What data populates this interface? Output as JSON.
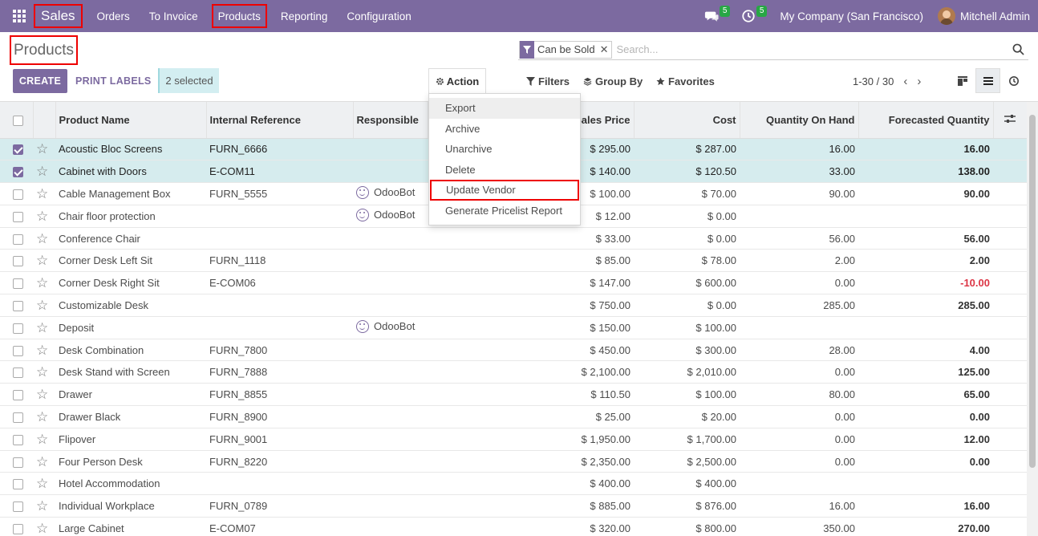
{
  "navbar": {
    "app_name": "Sales",
    "menus": [
      "Orders",
      "To Invoice",
      "Products",
      "Reporting",
      "Configuration"
    ],
    "messages_count": "5",
    "activities_count": "5",
    "company": "My Company (San Francisco)",
    "user": "Mitchell Admin"
  },
  "page": {
    "title": "Products",
    "create_label": "CREATE",
    "print_labels_label": "PRINT LABELS",
    "selected_label": "2 selected",
    "action_label": "Action",
    "filters_label": "Filters",
    "group_by_label": "Group By",
    "favorites_label": "Favorites",
    "pager": "1-30 / 30"
  },
  "search": {
    "facet": "Can be Sold",
    "placeholder": "Search..."
  },
  "action_menu": [
    "Export",
    "Archive",
    "Unarchive",
    "Delete",
    "Update Vendor",
    "Generate Pricelist Report"
  ],
  "table": {
    "columns": [
      "Product Name",
      "Internal Reference",
      "Responsible",
      "Sales Price",
      "Cost",
      "Quantity On Hand",
      "Forecasted Quantity"
    ],
    "rows": [
      {
        "name": "Acoustic Bloc Screens",
        "ref": "FURN_6666",
        "resp": "",
        "price": "$ 295.00",
        "cost": "$ 287.00",
        "qoh": "16.00",
        "fq": "16.00",
        "selected": true
      },
      {
        "name": "Cabinet with Doors",
        "ref": "E-COM11",
        "resp": "",
        "price": "$ 140.00",
        "cost": "$ 120.50",
        "qoh": "33.00",
        "fq": "138.00",
        "selected": true
      },
      {
        "name": "Cable Management Box",
        "ref": "FURN_5555",
        "resp": "OdooBot",
        "price": "$ 100.00",
        "cost": "$ 70.00",
        "qoh": "90.00",
        "fq": "90.00"
      },
      {
        "name": "Chair floor protection",
        "ref": "",
        "resp": "OdooBot",
        "price": "$ 12.00",
        "cost": "$ 0.00",
        "qoh": "",
        "fq": ""
      },
      {
        "name": "Conference Chair",
        "ref": "",
        "resp": "",
        "price": "$ 33.00",
        "cost": "$ 0.00",
        "qoh": "56.00",
        "fq": "56.00"
      },
      {
        "name": "Corner Desk Left Sit",
        "ref": "FURN_1118",
        "resp": "",
        "price": "$ 85.00",
        "cost": "$ 78.00",
        "qoh": "2.00",
        "fq": "2.00"
      },
      {
        "name": "Corner Desk Right Sit",
        "ref": "E-COM06",
        "resp": "",
        "price": "$ 147.00",
        "cost": "$ 600.00",
        "qoh": "0.00",
        "fq": "-10.00",
        "negative": true
      },
      {
        "name": "Customizable Desk",
        "ref": "",
        "resp": "",
        "price": "$ 750.00",
        "cost": "$ 0.00",
        "qoh": "285.00",
        "fq": "285.00"
      },
      {
        "name": "Deposit",
        "ref": "",
        "resp": "OdooBot",
        "price": "$ 150.00",
        "cost": "$ 100.00",
        "qoh": "",
        "fq": ""
      },
      {
        "name": "Desk Combination",
        "ref": "FURN_7800",
        "resp": "",
        "price": "$ 450.00",
        "cost": "$ 300.00",
        "qoh": "28.00",
        "fq": "4.00"
      },
      {
        "name": "Desk Stand with Screen",
        "ref": "FURN_7888",
        "resp": "",
        "price": "$ 2,100.00",
        "cost": "$ 2,010.00",
        "qoh": "0.00",
        "fq": "125.00"
      },
      {
        "name": "Drawer",
        "ref": "FURN_8855",
        "resp": "",
        "price": "$ 110.50",
        "cost": "$ 100.00",
        "qoh": "80.00",
        "fq": "65.00"
      },
      {
        "name": "Drawer Black",
        "ref": "FURN_8900",
        "resp": "",
        "price": "$ 25.00",
        "cost": "$ 20.00",
        "qoh": "0.00",
        "fq": "0.00"
      },
      {
        "name": "Flipover",
        "ref": "FURN_9001",
        "resp": "",
        "price": "$ 1,950.00",
        "cost": "$ 1,700.00",
        "qoh": "0.00",
        "fq": "12.00"
      },
      {
        "name": "Four Person Desk",
        "ref": "FURN_8220",
        "resp": "",
        "price": "$ 2,350.00",
        "cost": "$ 2,500.00",
        "qoh": "0.00",
        "fq": "0.00"
      },
      {
        "name": "Hotel Accommodation",
        "ref": "",
        "resp": "",
        "price": "$ 400.00",
        "cost": "$ 400.00",
        "qoh": "",
        "fq": ""
      },
      {
        "name": "Individual Workplace",
        "ref": "FURN_0789",
        "resp": "",
        "price": "$ 885.00",
        "cost": "$ 876.00",
        "qoh": "16.00",
        "fq": "16.00"
      },
      {
        "name": "Large Cabinet",
        "ref": "E-COM07",
        "resp": "",
        "price": "$ 320.00",
        "cost": "$ 800.00",
        "qoh": "350.00",
        "fq": "270.00"
      }
    ]
  },
  "colors": {
    "brand": "#7c6aa0",
    "selected_row": "#d6ecee",
    "negative": "#dc3545",
    "badge": "#28a745"
  }
}
